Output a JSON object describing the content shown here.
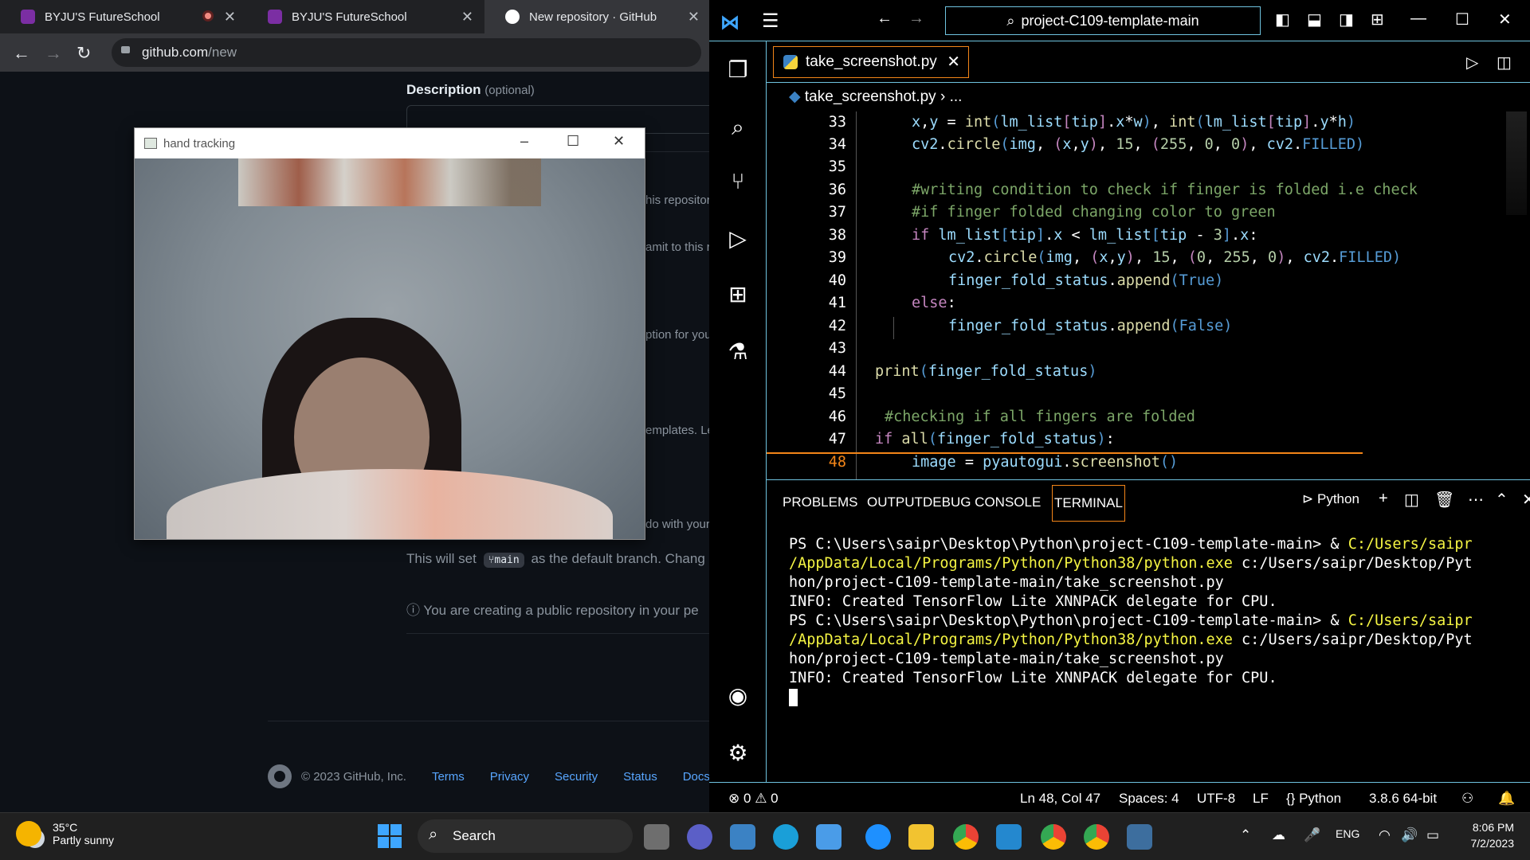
{
  "browser": {
    "tabs": [
      {
        "label": "BYJU'S FutureSchool"
      },
      {
        "label": "BYJU'S FutureSchool"
      },
      {
        "label": "New repository · GitHub"
      }
    ],
    "url_host": "github.com",
    "url_path": "/new"
  },
  "github": {
    "description_label": "Description",
    "description_optional": "(optional)",
    "partial_texts": [
      "his repository",
      "amit to this r",
      "ption for you",
      "emplates. Le",
      "do with your"
    ],
    "branch_note_prefix": "This will set",
    "branch_name": "main",
    "branch_note_suffix": "as the default branch. Chang",
    "public_note": "You are creating a public repository in your pe",
    "footer": {
      "copyright": "© 2023 GitHub, Inc.",
      "links": [
        "Terms",
        "Privacy",
        "Security",
        "Status",
        "Docs"
      ]
    }
  },
  "hand_window": {
    "title": "hand tracking"
  },
  "vscode": {
    "search": "project-C109-template-main",
    "tab": "take_screenshot.py",
    "breadcrumb_file": "take_screenshot.py",
    "breadcrumb_more": "...",
    "line_numbers": [
      "33",
      "34",
      "35",
      "36",
      "37",
      "38",
      "39",
      "40",
      "41",
      "42",
      "43",
      "44",
      "45",
      "46",
      "47",
      "48"
    ],
    "panel_tabs": [
      "PROBLEMS",
      "OUTPUT",
      "DEBUG CONSOLE",
      "TERMINAL"
    ],
    "terminal_profile": "Python",
    "terminal": {
      "prompt1": "PS C:\\Users\\saipr\\Desktop\\Python\\project-C109-template-main> & ",
      "exe1a": "C:/Users/saipr",
      "exe1b": "/AppData/Local/Programs/Python/Python38/python.exe",
      "arg1a": " c:/Users/saipr/Desktop/Pyt",
      "arg1b": "hon/project-C109-template-main/take_screenshot.py",
      "info1": "INFO: Created TensorFlow Lite XNNPACK delegate for CPU."
    },
    "status": {
      "errors": "0",
      "warnings": "0",
      "position": "Ln 48, Col 47",
      "spaces": "Spaces: 4",
      "encoding": "UTF-8",
      "eol": "LF",
      "language": "Python",
      "interpreter": "3.8.6 64-bit"
    }
  },
  "taskbar": {
    "temperature": "35°C",
    "weather": "Partly sunny",
    "search": "Search",
    "language": "ENG",
    "time": "8:06 PM",
    "date": "7/2/2023"
  }
}
